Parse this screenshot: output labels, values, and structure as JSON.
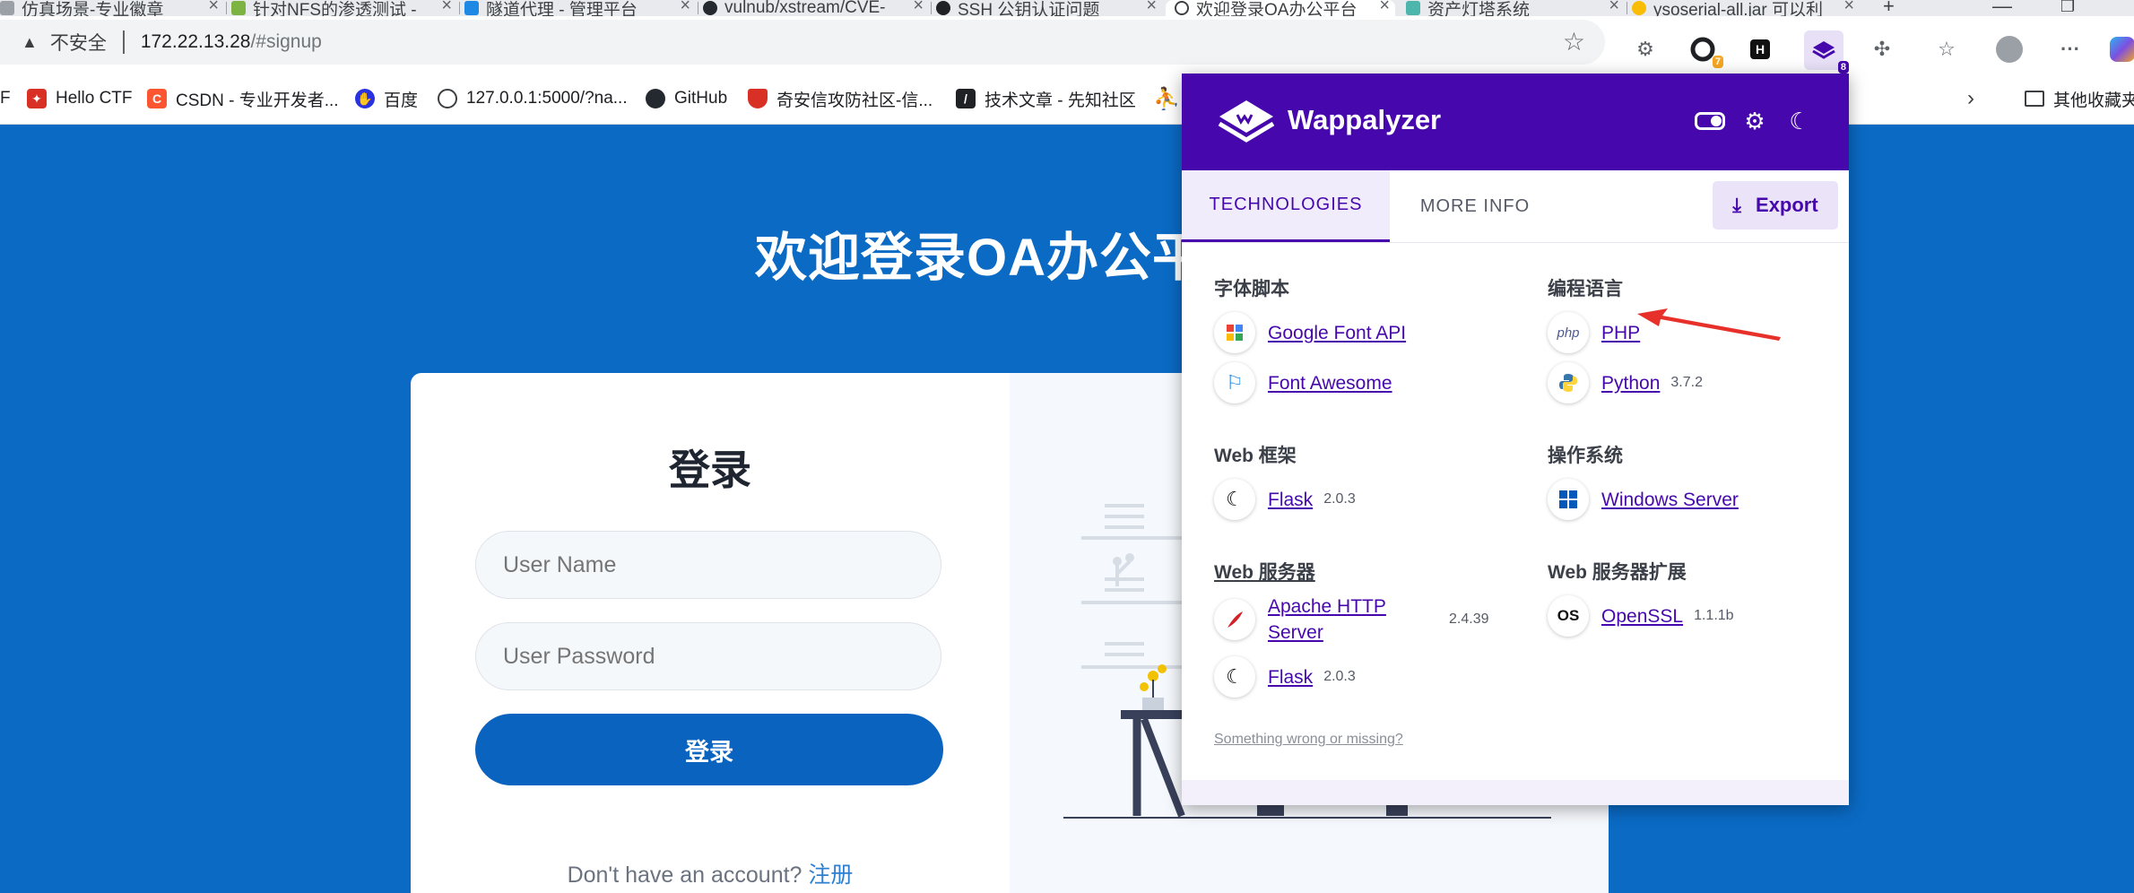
{
  "browser": {
    "tabs": [
      {
        "title": "仿真场景-专业徽章",
        "color": "#9aa0a6"
      },
      {
        "title": "针对NFS的渗透测试 -",
        "color": "#7cb342"
      },
      {
        "title": "隧道代理 - 管理平台",
        "color": "#1e88e5"
      },
      {
        "title": "vulnub/xstream/CVE-",
        "color": "#24292f"
      },
      {
        "title": "SSH 公钥认证问题",
        "color": "#202124"
      },
      {
        "title": "欢迎登录OA办公平台",
        "color": "#3c4043"
      },
      {
        "title": "资产灯塔系统",
        "color": "#4db6ac"
      },
      {
        "title": "ysoserial-all.jar 可以利",
        "color": "#fbbc04"
      }
    ],
    "new_tab": "+",
    "address": {
      "security_label": "不安全",
      "host": "172.22.13.28",
      "path": "/#signup"
    },
    "extension_badges": {
      "ext2": "7",
      "wappalyzer": "8"
    },
    "bookmarks": [
      "F",
      "Hello CTF",
      "CSDN - 专业开发者...",
      "百度",
      "127.0.0.1:5000/?na...",
      "GitHub",
      "奇安信攻防社区-信...",
      "技术文章 - 先知社区"
    ],
    "other_bookmarks": "其他收藏夹"
  },
  "page": {
    "title": "欢迎登录OA办公平台",
    "login_heading": "登录",
    "username_placeholder": "User Name",
    "password_placeholder": "User Password",
    "login_button": "登录",
    "signup_prompt": "Don't have an account?",
    "signup_link": "注册"
  },
  "wappalyzer": {
    "brand": "Wappalyzer",
    "tabs": {
      "technologies": "TECHNOLOGIES",
      "more_info": "MORE INFO"
    },
    "export": "Export",
    "categories": {
      "font_scripts": {
        "label": "字体脚本",
        "items": [
          {
            "name": "Google Font API",
            "version": ""
          },
          {
            "name": "Font Awesome",
            "version": ""
          }
        ]
      },
      "programming_languages": {
        "label": "编程语言",
        "items": [
          {
            "name": "PHP",
            "version": ""
          },
          {
            "name": "Python",
            "version": "3.7.2"
          }
        ]
      },
      "web_frameworks": {
        "label": "Web 框架",
        "items": [
          {
            "name": "Flask",
            "version": "2.0.3"
          }
        ]
      },
      "operating_systems": {
        "label": "操作系统",
        "items": [
          {
            "name": "Windows Server",
            "version": ""
          }
        ]
      },
      "web_servers": {
        "label": "Web 服务器",
        "items": [
          {
            "name": "Apache HTTP Server",
            "version": "2.4.39"
          },
          {
            "name": "Flask",
            "version": "2.0.3"
          }
        ]
      },
      "web_server_extensions": {
        "label": "Web 服务器扩展",
        "items": [
          {
            "name": "OpenSSL",
            "version": "1.1.1b"
          }
        ]
      }
    },
    "footer_link": "Something wrong or missing?",
    "icons": {
      "php": "php",
      "openssl": "OS"
    }
  },
  "colors": {
    "page_background": "#0a6ac4",
    "wappalyzer_purple": "#4608ad",
    "login_button": "#0a63bf",
    "annotation_arrow": "#e8302a"
  }
}
